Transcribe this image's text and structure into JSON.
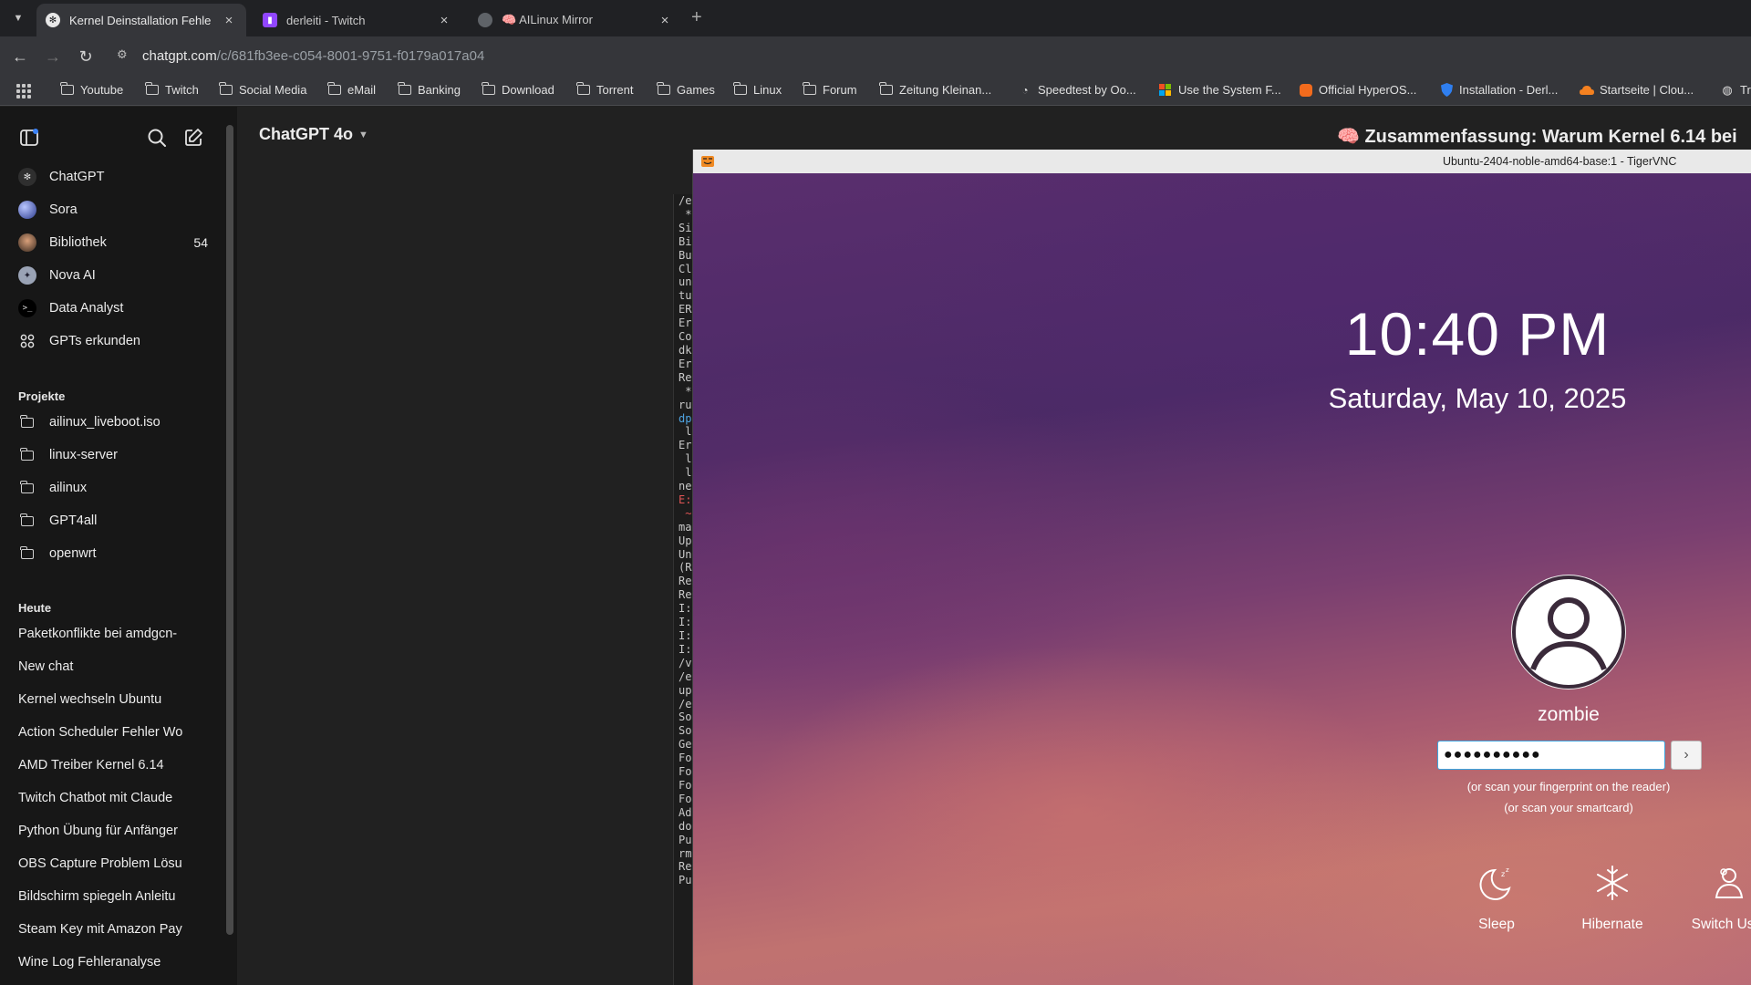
{
  "browser": {
    "tabs": [
      {
        "title": "Kernel Deinstallation Fehle",
        "active": true
      },
      {
        "title": "derleiti - Twitch",
        "active": false
      },
      {
        "title": "🧠 AILinux Mirror",
        "active": false
      }
    ],
    "url_host": "chatgpt.com",
    "url_path": "/c/681fb3ee-c054-8001-9751-f0179a017a04",
    "bookmarks": [
      "Youtube",
      "Twitch",
      "Social Media",
      "eMail",
      "Banking",
      "Download",
      "Torrent",
      "Games",
      "Linux",
      "Forum",
      "Zeitung Kleinan...",
      "Speedtest by Oo...",
      "Use the System F...",
      "Official HyperOS...",
      "Installation - Derl...",
      "Startseite | Clou...",
      "Tr"
    ]
  },
  "sidebar": {
    "items": [
      {
        "label": "ChatGPT",
        "icon": "chatgpt-logo-icon"
      },
      {
        "label": "Sora",
        "icon": "sora-icon"
      },
      {
        "label": "Bibliothek",
        "icon": "library-icon",
        "badge": "54"
      },
      {
        "label": "Nova AI",
        "icon": "nova-ai-icon"
      },
      {
        "label": "Data Analyst",
        "icon": "data-analyst-icon"
      },
      {
        "label": "GPTs erkunden",
        "icon": "explore-gpts-icon"
      }
    ],
    "projects_heading": "Projekte",
    "projects": [
      "ailinux_liveboot.iso",
      "linux-server",
      "ailinux",
      "GPT4all",
      "openwrt"
    ],
    "today_heading": "Heute",
    "chats": [
      "Paketkonflikte bei amdgcn-",
      "New chat",
      "Kernel wechseln Ubuntu",
      "Action Scheduler Fehler Wo",
      "AMD Treiber Kernel 6.14",
      "Twitch Chatbot mit Claude",
      "Python Übung für Anfänger",
      "OBS Capture Problem Lösu",
      "Bildschirm spiegeln Anleitu",
      "Steam Key mit Amazon Pay",
      "Wine Log Fehleranalyse"
    ]
  },
  "main": {
    "model": "ChatGPT 4o",
    "summary_title": "Zusammenfassung: Warum Kernel 6.14 bei"
  },
  "terminal_lines": [
    "/e",
    " *",
    "Si",
    "Bi",
    "",
    "Bu",
    "Cl",
    "un",
    "tu",
    "ER",
    "Er",
    "Co",
    "dk",
    "Er",
    "Re",
    " *",
    "",
    "ru",
    "dp",
    " l",
    "Er",
    " l",
    " l",
    "ne",
    "E:",
    " ~",
    "ma",
    "Up",
    "Un",
    "(R",
    "Re",
    "Re",
    "I:",
    "I:",
    "I:",
    "I:",
    "/v",
    "/e",
    "up",
    "/e",
    "So",
    "So",
    "Ge",
    "Fo",
    "Fo",
    "Fo",
    "Fo",
    "Ad",
    "do",
    "Pu",
    "rm",
    "Re",
    "Pu"
  ],
  "vnc": {
    "window_title": "Ubuntu-2404-noble-amd64-base:1 - TigerVNC",
    "time": "10:40 PM",
    "date": "Saturday, May 10, 2025",
    "user": "zombie",
    "password_mask": "●●●●●●●●●●",
    "hint_fingerprint": "(or scan your fingerprint on the reader)",
    "hint_smartcard": "(or scan your smartcard)",
    "actions": [
      "Sleep",
      "Hibernate",
      "Switch User"
    ]
  }
}
